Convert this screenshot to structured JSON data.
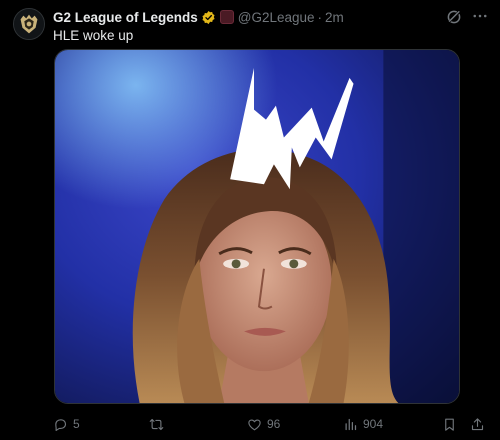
{
  "tweet": {
    "author": {
      "display_name": "G2 League of Legends",
      "handle": "@G2League",
      "separator": "·",
      "time": "2m",
      "verified_icon": "verified-badge-icon",
      "affiliate_icon": "affiliate-badge-icon"
    },
    "text": "HLE woke up",
    "media": {
      "type": "photo",
      "alt_visible": false
    },
    "actions": {
      "reply_count": "5",
      "retweet_count": "",
      "like_count": "96",
      "views_count": "904"
    }
  },
  "colors": {
    "background": "#000000",
    "text_primary": "#e7e9ea",
    "text_secondary": "#71767b",
    "verified_gold": "#e2b719",
    "border": "#2f3336"
  }
}
